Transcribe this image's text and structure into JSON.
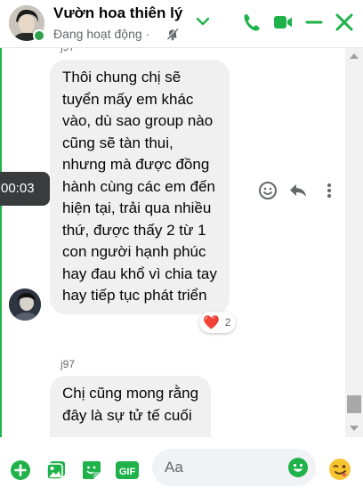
{
  "header": {
    "contact_name": "Vườn hoa thiên lý",
    "status": "Đang hoạt động ·"
  },
  "messages": [
    {
      "sender": "j97",
      "lines": [
        "Thôi chung chị sẽ",
        "tuyển mấy em khác",
        "vào, dù sao group nào",
        "cũng sẽ tàn thui,",
        "nhưng mà được đồng",
        "hành cùng các em đến",
        "hiện tại, trải qua nhiều",
        "thứ, được thấy 2 từ 1",
        "con người hạnh phúc",
        "hay đau khổ vì chia tay",
        "hay tiếp tục phát triển"
      ],
      "reaction": {
        "emoji": "❤️",
        "count": "2"
      }
    },
    {
      "sender": "j97",
      "lines": [
        "Chị cũng mong rằng",
        "đây là sự tử tế cuối"
      ]
    }
  ],
  "video_timestamp": "00:03",
  "composer": {
    "placeholder": "Aa"
  },
  "colors": {
    "accent_green": "#1fb24a",
    "bubble_bg": "#f0f0f0",
    "online": "#31a24c"
  },
  "icons": [
    "phone-icon",
    "video-camera-icon",
    "minimize-icon",
    "close-icon",
    "plus-circle-icon",
    "image-icon",
    "sticker-icon",
    "gif-icon",
    "emoji-icon",
    "reply-icon",
    "more-icon",
    "bell-off-icon",
    "chevron-down-icon",
    "wink-emoji-icon"
  ]
}
